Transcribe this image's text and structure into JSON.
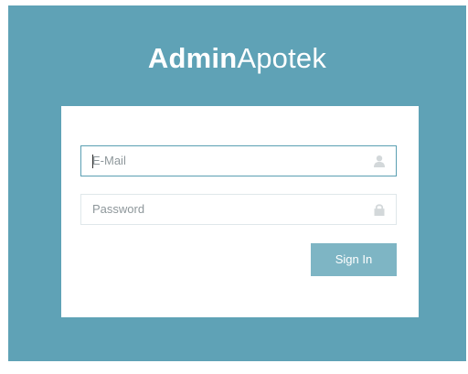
{
  "brand": {
    "bold": "Admin",
    "light": "Apotek"
  },
  "login": {
    "email_placeholder": "E-Mail",
    "email_icon": "user-icon",
    "password_placeholder": "Password",
    "password_icon": "lock-icon",
    "submit_label": "Sign In"
  },
  "colors": {
    "background": "#5fa2b6",
    "card": "#ffffff",
    "button": "#7eb5c4",
    "focus_border": "#5a9fb2"
  }
}
